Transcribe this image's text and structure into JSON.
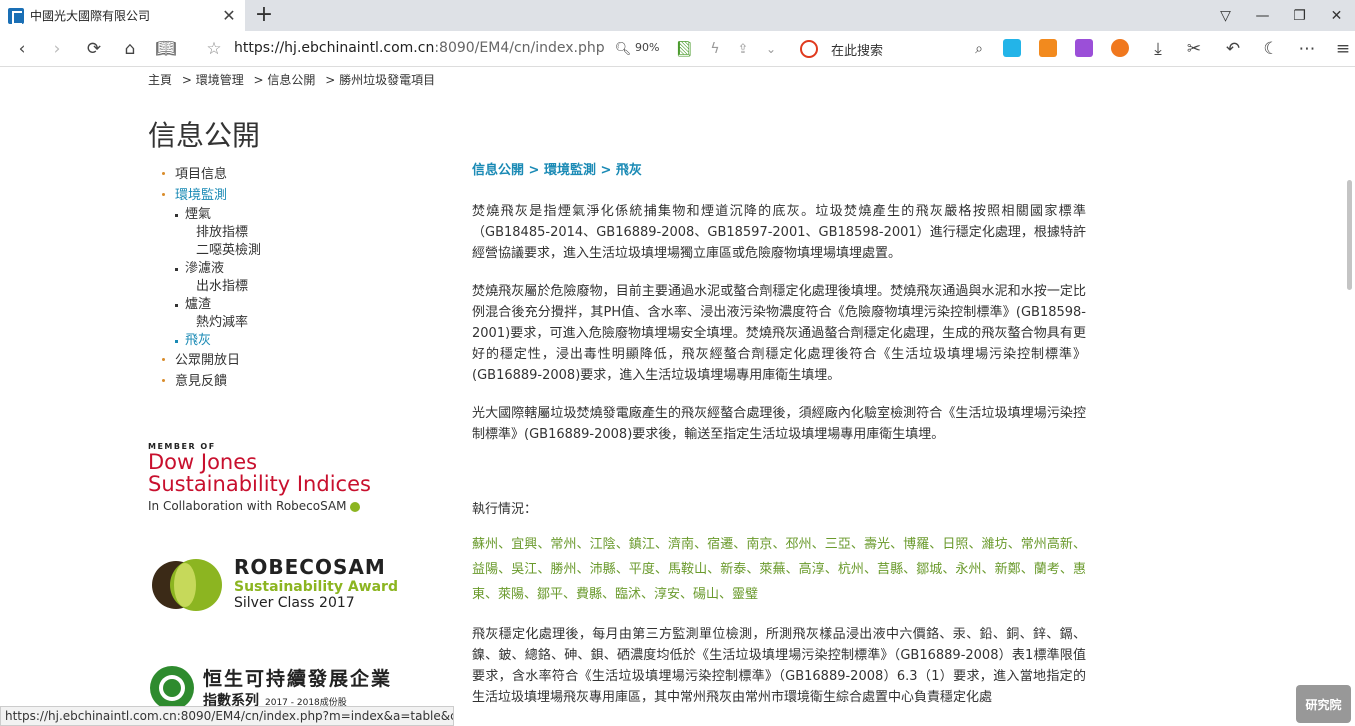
{
  "browser": {
    "tab_title": "中國光大國際有限公司",
    "url_host": "https://hj.ebchinaintl.com.cn",
    "url_rest": ":8090/EM4/cn/index.php",
    "zoom": "90%",
    "search_placeholder": "在此搜索",
    "status_url": "https://hj.ebchinaintl.com.cn:8090/EM4/cn/index.php?m=index&a=table&ci..."
  },
  "breadcrumb": [
    "主頁",
    "> 環境管理",
    "> 信息公開",
    "> 勝州垃圾發電項目"
  ],
  "page_title": "信息公開",
  "nav": {
    "item1": "項目信息",
    "item2": "環境監測",
    "sub1": "煙氣",
    "sub1a": "排放指標",
    "sub1b": "二噁英檢測",
    "sub2": "滲濾液",
    "sub2a": "出水指標",
    "sub3": "爐渣",
    "sub3a": "熱灼減率",
    "sub4": "飛灰",
    "item3": "公眾開放日",
    "item4": "意見反饋"
  },
  "logos": {
    "djsi_member": "MEMBER OF",
    "djsi_line1": "Dow Jones",
    "djsi_line2": "Sustainability Indices",
    "djsi_collab": "In Collaboration with RobecoSAM",
    "robeco_brand": "ROBECOSAM",
    "robeco_award": "Sustainability Award",
    "robeco_class": "Silver Class 2017",
    "hs_title": "恒生可持續發展企業",
    "hs_sub": "指數系列",
    "hs_year": "2017 - 2018成份股"
  },
  "content": {
    "section_title": "信息公開 > 環境監測 > 飛灰",
    "p1": "焚燒飛灰是指煙氣淨化係統捕集物和煙道沉降的底灰。垃圾焚燒產生的飛灰嚴格按照相關國家標準（GB18485-2014、GB16889-2008、GB18597-2001、GB18598-2001）進行穩定化處理，根據特許經營協議要求，進入生活垃圾填埋場獨立庫區或危險廢物填埋場填埋處置。",
    "p2": "焚燒飛灰屬於危險廢物，目前主要通過水泥或螯合劑穩定化處理後填埋。焚燒飛灰通過與水泥和水按一定比例混合後充分攪拌，其PH值、含水率、浸出液污染物濃度符合《危險廢物填埋污染控制標準》(GB18598-2001)要求，可進入危險廢物填埋場安全填埋。焚燒飛灰通過螯合劑穩定化處理，生成的飛灰螯合物具有更好的穩定性，浸出毒性明顯降低，飛灰經螯合劑穩定化處理後符合《生活垃圾填埋場污染控制標準》(GB16889-2008)要求，進入生活垃圾填埋場專用庫衛生填埋。",
    "p3": "光大國際轄屬垃圾焚燒發電廠產生的飛灰經螯合處理後，須經廠內化驗室檢測符合《生活垃圾填埋場污染控制標準》(GB16889-2008)要求後，輸送至指定生活垃圾填埋場專用庫衛生填埋。",
    "p4": "執行情況：",
    "cities": "蘇州、宜興、常州、江陰、鎮江、濟南、宿遷、南京、邳州、三亞、壽光、博羅、日照、濰坊、常州高新、益陽、吳江、勝州、沛縣、平度、馬鞍山、新泰、萊蕪、高淳、杭州、莒縣、鄒城、永州、新鄭、蘭考、惠東、萊陽、鄒平、費縣、臨沭、淳安、碭山、靈璧",
    "p5": "飛灰穩定化處理後，每月由第三方監測單位檢測，所測飛灰樣品浸出液中六價鉻、汞、鉛、銅、鋅、鎘、鎳、鈹、總鉻、砷、鋇、硒濃度均低於《生活垃圾填埋場污染控制標準》（GB16889-2008）表1標準限值要求，含水率符合《生活垃圾填埋場污染控制標準》（GB16889-2008）6.3（1）要求，進入當地指定的生活垃圾填埋場飛灰專用庫區，其中常州飛灰由常州市環境衛生綜合處置中心負責穩定化處"
  },
  "watermark": "研究院",
  "colors": {
    "accent": "#1a8ab5",
    "city_green": "#6a9a2c",
    "djsi_red": "#c8102e",
    "robeco_green": "#8cb521"
  }
}
